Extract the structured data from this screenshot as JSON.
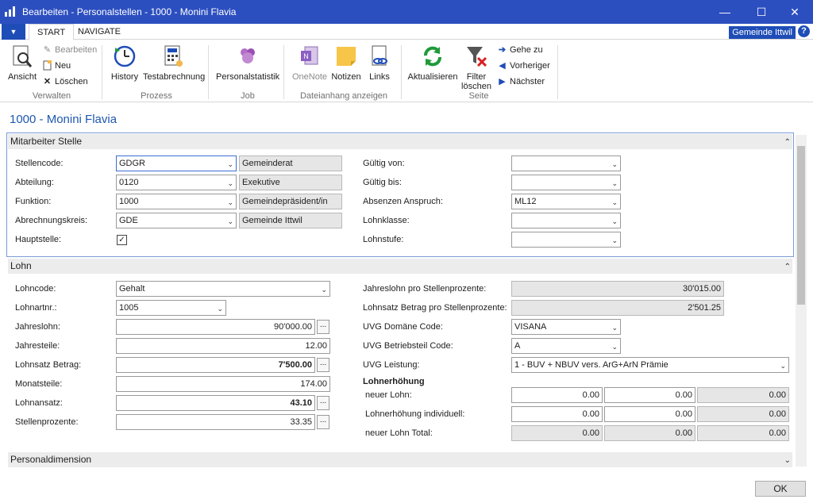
{
  "window": {
    "title": "Bearbeiten - Personalstellen - 1000 - Monini Flavia"
  },
  "ribbon": {
    "tabs": [
      {
        "label": "START"
      },
      {
        "label": "NAVIGATE"
      }
    ],
    "company": "Gemeinde Ittwil",
    "help": "?",
    "groups": {
      "verwalten": {
        "label": "Verwalten",
        "ansicht": "Ansicht",
        "bearbeiten": "Bearbeiten",
        "neu": "Neu",
        "loeschen": "Löschen"
      },
      "prozess": {
        "label": "Prozess",
        "history": "History",
        "testabrechnung": "Testabrechnung"
      },
      "job": {
        "label": "Job",
        "personalstatistik": "Personalstatistik"
      },
      "dateianhang": {
        "label": "Dateianhang anzeigen",
        "onenote": "OneNote",
        "notizen": "Notizen",
        "links": "Links"
      },
      "seite": {
        "label": "Seite",
        "aktualisieren": "Aktualisieren",
        "filter1": "Filter",
        "filter2": "löschen",
        "gehe_zu": "Gehe zu",
        "vorheriger": "Vorheriger",
        "naechster": "Nächster"
      }
    }
  },
  "page": {
    "title": "1000 - Monini Flavia"
  },
  "mitarbeiter": {
    "heading": "Mitarbeiter Stelle",
    "stellencode": {
      "label": "Stellencode:",
      "value": "GDGR",
      "desc": "Gemeinderat"
    },
    "abteilung": {
      "label": "Abteilung:",
      "value": "0120",
      "desc": "Exekutive"
    },
    "funktion": {
      "label": "Funktion:",
      "value": "1000",
      "desc": "Gemeindepräsident/in"
    },
    "abrechnungskreis": {
      "label": "Abrechnungskreis:",
      "value": "GDE",
      "desc": "Gemeinde Ittwil"
    },
    "hauptstelle": {
      "label": "Hauptstelle:",
      "checked": true,
      "mark": "✓"
    },
    "gueltig_von": {
      "label": "Gültig von:",
      "value": ""
    },
    "gueltig_bis": {
      "label": "Gültig bis:",
      "value": ""
    },
    "absenzen": {
      "label": "Absenzen Anspruch:",
      "value": "ML12"
    },
    "lohnklasse": {
      "label": "Lohnklasse:",
      "value": ""
    },
    "lohnstufe": {
      "label": "Lohnstufe:",
      "value": ""
    }
  },
  "lohn": {
    "heading": "Lohn",
    "lohncode": {
      "label": "Lohncode:",
      "value": "Gehalt"
    },
    "lohnartnr": {
      "label": "Lohnartnr.:",
      "value": "1005"
    },
    "jahreslohn": {
      "label": "Jahreslohn:",
      "value": "90'000.00"
    },
    "jahresteile": {
      "label": "Jahresteile:",
      "value": "12.00"
    },
    "lohnsatz_betrag": {
      "label": "Lohnsatz Betrag:",
      "value": "7'500.00"
    },
    "monatsteile": {
      "label": "Monatsteile:",
      "value": "174.00"
    },
    "lohnansatz": {
      "label": "Lohnansatz:",
      "value": "43.10"
    },
    "stellenprozente": {
      "label": "Stellenprozente:",
      "value": "33.35"
    },
    "jahreslohn_pro": {
      "label": "Jahreslohn pro Stellenprozente:",
      "value": "30'015.00"
    },
    "lohnsatz_pro": {
      "label": "Lohnsatz Betrag pro Stellenprozente:",
      "value": "2'501.25"
    },
    "uvg_domaene": {
      "label": "UVG Domäne Code:",
      "value": "VISANA"
    },
    "uvg_betrieb": {
      "label": "UVG Betriebsteil Code:",
      "value": "A"
    },
    "uvg_leistung": {
      "label": "UVG Leistung:",
      "value": "1 - BUV + NBUV vers. ArG+ArN Prämie"
    },
    "lohnerhoehung": {
      "heading": "Lohnerhöhung",
      "neuer_lohn": {
        "label": "neuer Lohn:",
        "values": [
          "0.00",
          "0.00",
          "0.00"
        ]
      },
      "individuell": {
        "label": "Lohnerhöhung individuell:",
        "values": [
          "0.00",
          "0.00",
          "0.00"
        ]
      },
      "total": {
        "label": "neuer Lohn Total:",
        "values": [
          "0.00",
          "0.00",
          "0.00"
        ]
      }
    },
    "ellipsis": "..."
  },
  "personaldimension": {
    "heading": "Personaldimension"
  },
  "footer": {
    "ok": "OK"
  }
}
